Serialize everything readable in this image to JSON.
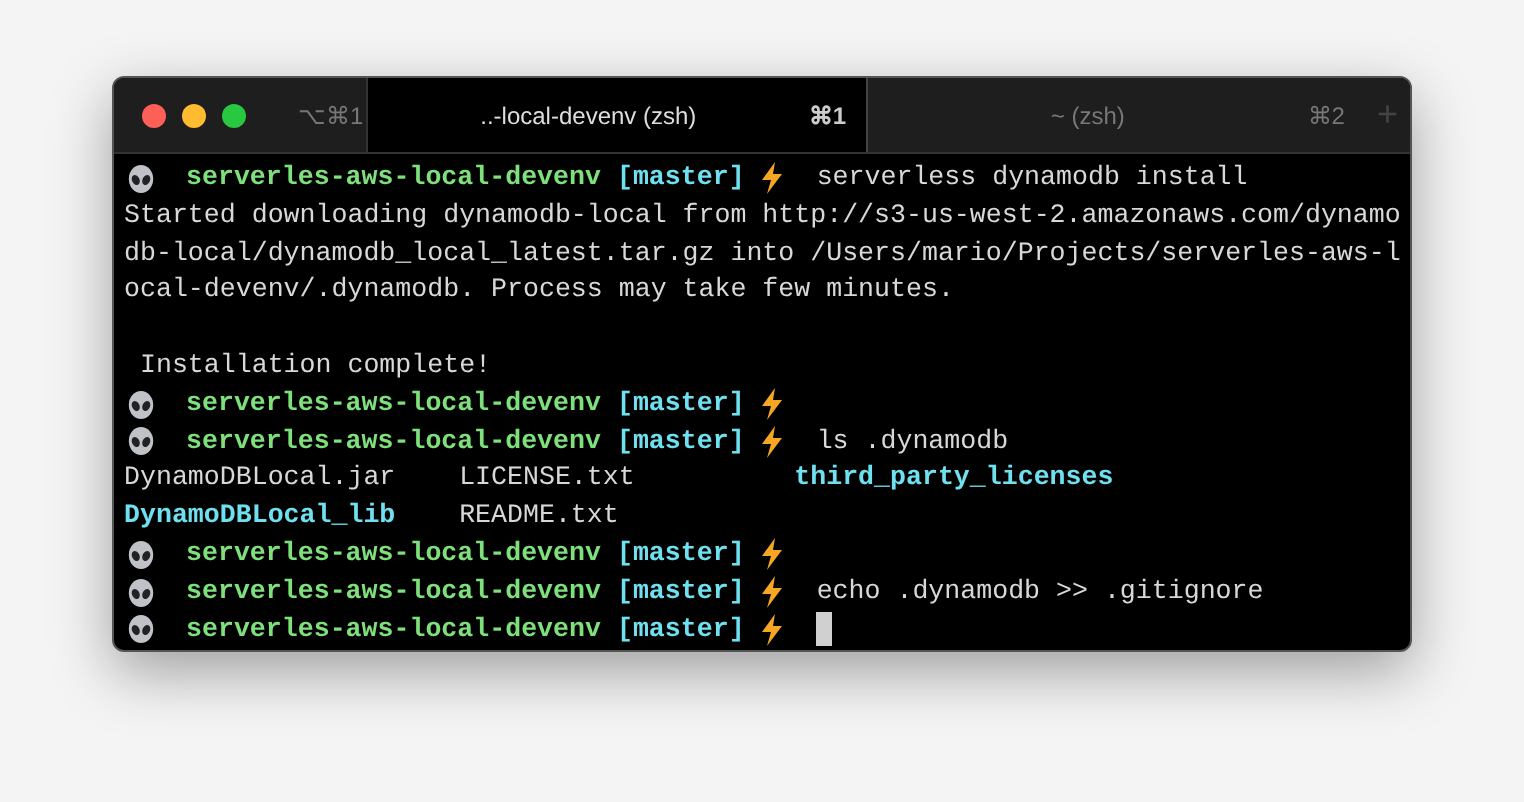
{
  "window": {
    "shortcut": "⌥⌘1"
  },
  "tabs": [
    {
      "title": "..-local-devenv (zsh)",
      "shortcut": "⌘1",
      "selected": true
    },
    {
      "title": "~ (zsh)",
      "shortcut": "⌘2",
      "selected": false
    }
  ],
  "new_tab": "+",
  "lines": [
    {
      "kind": "prompt",
      "dir": "serverles-aws-local-devenv",
      "branch": "[master]",
      "command": "serverless dynamodb install"
    },
    {
      "kind": "output",
      "text": "Started downloading dynamodb-local from http://s3-us-west-2.amazonaws.com/dynamodb-local/dynamodb_local_latest.tar.gz into /Users/mario/Projects/serverles-aws-local-devenv/.dynamodb. Process may take few minutes."
    },
    {
      "kind": "blank"
    },
    {
      "kind": "output",
      "text": " Installation complete!"
    },
    {
      "kind": "prompt",
      "dir": "serverles-aws-local-devenv",
      "branch": "[master]"
    },
    {
      "kind": "prompt",
      "dir": "serverles-aws-local-devenv",
      "branch": "[master]",
      "command": "ls .dynamodb"
    },
    {
      "kind": "listing",
      "entries": [
        {
          "name": "DynamoDBLocal.jar",
          "kind": "file"
        },
        {
          "name": "LICENSE.txt",
          "kind": "file"
        },
        {
          "name": "third_party_licenses",
          "kind": "dir"
        }
      ]
    },
    {
      "kind": "listing",
      "entries": [
        {
          "name": "DynamoDBLocal_lib",
          "kind": "dir"
        },
        {
          "name": "README.txt",
          "kind": "file"
        }
      ]
    },
    {
      "kind": "prompt",
      "dir": "serverles-aws-local-devenv",
      "branch": "[master]"
    },
    {
      "kind": "prompt",
      "dir": "serverles-aws-local-devenv",
      "branch": "[master]",
      "command": "echo .dynamodb >> .gitignore"
    },
    {
      "kind": "prompt",
      "dir": "serverles-aws-local-devenv",
      "branch": "[master]",
      "cursor": true
    }
  ]
}
